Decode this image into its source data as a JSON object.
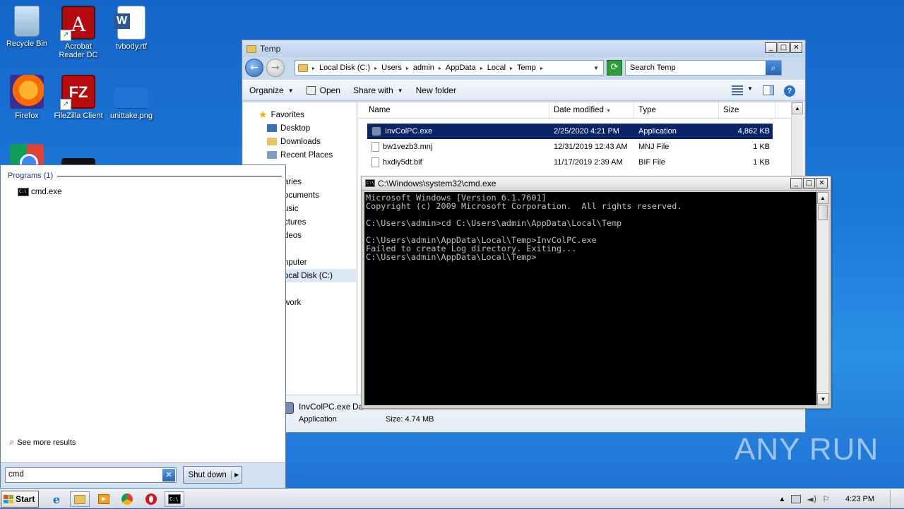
{
  "desktop": {
    "icons": [
      {
        "label": "Recycle Bin",
        "icon": "recycle-bin-icon"
      },
      {
        "label": "Acrobat Reader DC",
        "icon": "acrobat-icon"
      },
      {
        "label": "tvbody.rtf",
        "icon": "word-doc-icon"
      },
      {
        "label": "Firefox",
        "icon": "firefox-icon"
      },
      {
        "label": "FileZilla Client",
        "icon": "filezilla-icon"
      },
      {
        "label": "unittake.png",
        "icon": "image-file-icon"
      }
    ]
  },
  "explorer": {
    "title": "Temp",
    "breadcrumbs": [
      "Local Disk (C:)",
      "Users",
      "admin",
      "AppData",
      "Local",
      "Temp"
    ],
    "search_placeholder": "Search Temp",
    "toolbar": {
      "organize": "Organize",
      "open": "Open",
      "share_with": "Share with",
      "new_folder": "New folder"
    },
    "nav": {
      "favorites": "Favorites",
      "fav_items": [
        "Desktop",
        "Downloads",
        "Recent Places"
      ],
      "other_items": [
        "aries",
        "ocuments",
        "usic",
        "ctures",
        "deos",
        "nputer",
        "ocal Disk (C:)",
        "work"
      ]
    },
    "columns": [
      "Name",
      "Date modified",
      "Type",
      "Size"
    ],
    "files": [
      {
        "name": "InvColPC.exe",
        "date": "2/25/2020 4:21 PM",
        "type": "Application",
        "size": "4,862 KB"
      },
      {
        "name": "bw1vezb3.mnj",
        "date": "12/31/2019 12:43 AM",
        "type": "MNJ File",
        "size": "1 KB"
      },
      {
        "name": "hxdiy5dt.bif",
        "date": "11/17/2019 2:39 AM",
        "type": "BIF File",
        "size": "1 KB"
      }
    ],
    "details": {
      "name": "InvColPC.exe",
      "name_suffix": "Da",
      "type": "Application",
      "size": "Size: 4.74 MB"
    }
  },
  "cmd": {
    "title": "C:\\Windows\\system32\\cmd.exe",
    "output": "Microsoft Windows [Version 6.1.7601]\nCopyright (c) 2009 Microsoft Corporation.  All rights reserved.\n\nC:\\Users\\admin>cd C:\\Users\\admin\\AppData\\Local\\Temp\n\nC:\\Users\\admin\\AppData\\Local\\Temp>InvColPC.exe\nFailed to create Log directory. Exiting...\nC:\\Users\\admin\\AppData\\Local\\Temp>"
  },
  "start_menu": {
    "group_label": "Programs (1)",
    "result": "cmd.exe",
    "see_more": "See more results",
    "search_value": "cmd",
    "shutdown_label": "Shut down"
  },
  "taskbar": {
    "start_label": "Start",
    "clock": "4:23 PM"
  },
  "watermark": "ANY RUN"
}
